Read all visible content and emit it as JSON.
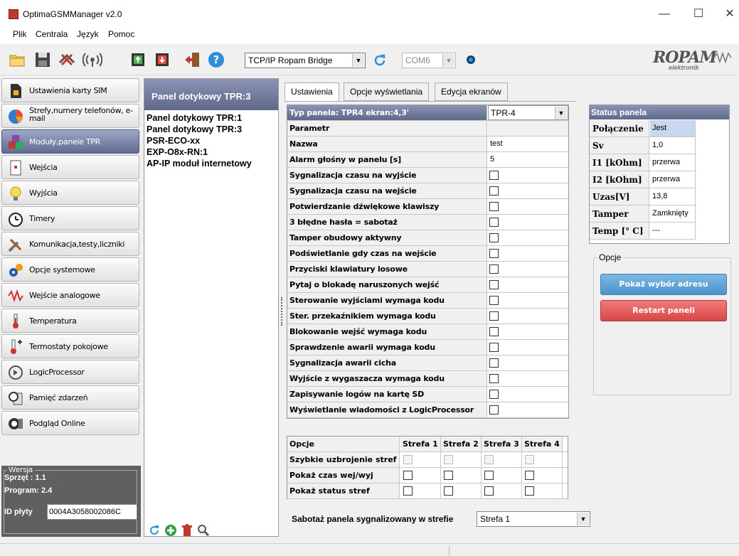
{
  "app": {
    "title": "OptimaGSMManager v2.0"
  },
  "window_controls": {
    "minimize": "—",
    "maximize": "☐",
    "close": "✕"
  },
  "menu": [
    "Plik",
    "Centrala",
    "Język",
    "Pomoc"
  ],
  "toolbar": {
    "connection": "TCP/IP Ropam Bridge",
    "port": "COM6",
    "logo": "ROPAM",
    "logo_sub": "elektronik"
  },
  "sidebar": [
    {
      "label": "Ustawienia karty SIM",
      "icon": "sim-card-icon"
    },
    {
      "label": "Strefy,numery telefonów, e-mail",
      "icon": "pie-chart-icon"
    },
    {
      "label": "Moduły,panele TPR",
      "icon": "modules-icon",
      "active": true
    },
    {
      "label": "Wejścia",
      "icon": "inputs-icon"
    },
    {
      "label": "Wyjścia",
      "icon": "bulb-icon"
    },
    {
      "label": "Timery",
      "icon": "clock-icon"
    },
    {
      "label": "Komunikacja,testy,liczniki",
      "icon": "tools-icon"
    },
    {
      "label": "Opcje systemowe",
      "icon": "gears-icon"
    },
    {
      "label": "Wejście analogowe",
      "icon": "wave-icon"
    },
    {
      "label": "Temperatura",
      "icon": "thermometer-icon"
    },
    {
      "label": "Termostaty pokojowe",
      "icon": "thermostat-icon"
    },
    {
      "label": "LogicProcessor",
      "icon": "logic-icon"
    },
    {
      "label": "Pamięć zdarzeń",
      "icon": "event-memory-icon"
    },
    {
      "label": "Podgląd Online",
      "icon": "online-preview-icon"
    }
  ],
  "version": {
    "legend": "Wersja",
    "hw": "Sprzęt : 1.1",
    "fw": "Program: 2.4",
    "id_label": "ID płyty",
    "id_value": "0004A3058002086C"
  },
  "panel_list": {
    "header": "Panel dotykowy TPR:3",
    "items": [
      "Panel dotykowy TPR:1",
      "Panel dotykowy TPR:3",
      "PSR-ECO-xx",
      "EXP-O8x-RN:1",
      "AP-IP moduł internetowy"
    ]
  },
  "tabs": [
    "Ustawienia",
    "Opcje wyświetlania",
    "Edycja ekranów"
  ],
  "settings": {
    "type_label": "Typ panela: TPR4 ekran:4,3'",
    "type_value": "TPR-4",
    "param_header": "Parametr",
    "rows": [
      {
        "label": "Nazwa",
        "value": "test"
      },
      {
        "label": "Alarm głośny w panelu [s]",
        "value": "5"
      },
      {
        "label": "Sygnalizacja czasu na wyjście",
        "check": false
      },
      {
        "label": "Sygnalizacja czasu na wejście",
        "check": false
      },
      {
        "label": "Potwierdzanie dźwiękowe klawiszy",
        "check": false
      },
      {
        "label": "3 błędne hasła = sabotaż",
        "check": false
      },
      {
        "label": "Tamper obudowy aktywny",
        "check": false
      },
      {
        "label": "Podświetlanie gdy czas na wejście",
        "check": false
      },
      {
        "label": "Przyciski klawiatury losowe",
        "check": false
      },
      {
        "label": "Pytaj o blokadę naruszonych wejść",
        "check": false
      },
      {
        "label": "Sterowanie wyjściami wymaga kodu",
        "check": false
      },
      {
        "label": "Ster. przekaźnikiem wymaga kodu",
        "check": false
      },
      {
        "label": "Blokowanie wejść wymaga kodu",
        "check": false
      },
      {
        "label": "Sprawdzenie awarii wymaga kodu",
        "check": false
      },
      {
        "label": "Sygnalizacja awarii cicha",
        "check": false
      },
      {
        "label": "Wyjście z wygaszacza wymaga kodu",
        "check": false
      },
      {
        "label": "Zapisywanie logów na kartę SD",
        "check": false
      },
      {
        "label": "Wyświetlanie wiadomości z LogicProcessor",
        "check": false
      }
    ]
  },
  "zone_options": {
    "header": "Opcje",
    "zones": [
      "Strefa 1",
      "Strefa 2",
      "Strefa 3",
      "Strefa 4"
    ],
    "rows": [
      {
        "label": "Szybkie uzbrojenie stref",
        "disabled": true
      },
      {
        "label": "Pokaż czas wej/wyj",
        "disabled": false
      },
      {
        "label": "Pokaż status stref",
        "disabled": false
      }
    ]
  },
  "sabotage": {
    "label": "Sabotaż panela sygnalizowany w strefie",
    "value": "Strefa 1"
  },
  "status": {
    "header": "Status panela",
    "rows": [
      {
        "label": "Połączenie",
        "value": "Jest"
      },
      {
        "label": "Sv",
        "value": "1,0"
      },
      {
        "label": "I1 [kOhm]",
        "value": "przerwa"
      },
      {
        "label": "I2 [kOhm]",
        "value": "przerwa"
      },
      {
        "label": "Uzas[V]",
        "value": "13,8"
      },
      {
        "label": "Tamper",
        "value": "Zamknięty"
      },
      {
        "label": "Temp [° C]",
        "value": "---"
      }
    ]
  },
  "options": {
    "legend": "Opcje",
    "show_address_button": "Pokaż wybór adresu",
    "restart_button": "Restart paneli"
  },
  "colors": {
    "active_gradient_top": "#9ea7c4",
    "active_gradient_bottom": "#5f6b93",
    "blue_button": "#5da3d6",
    "red_button": "#e45b5b"
  }
}
